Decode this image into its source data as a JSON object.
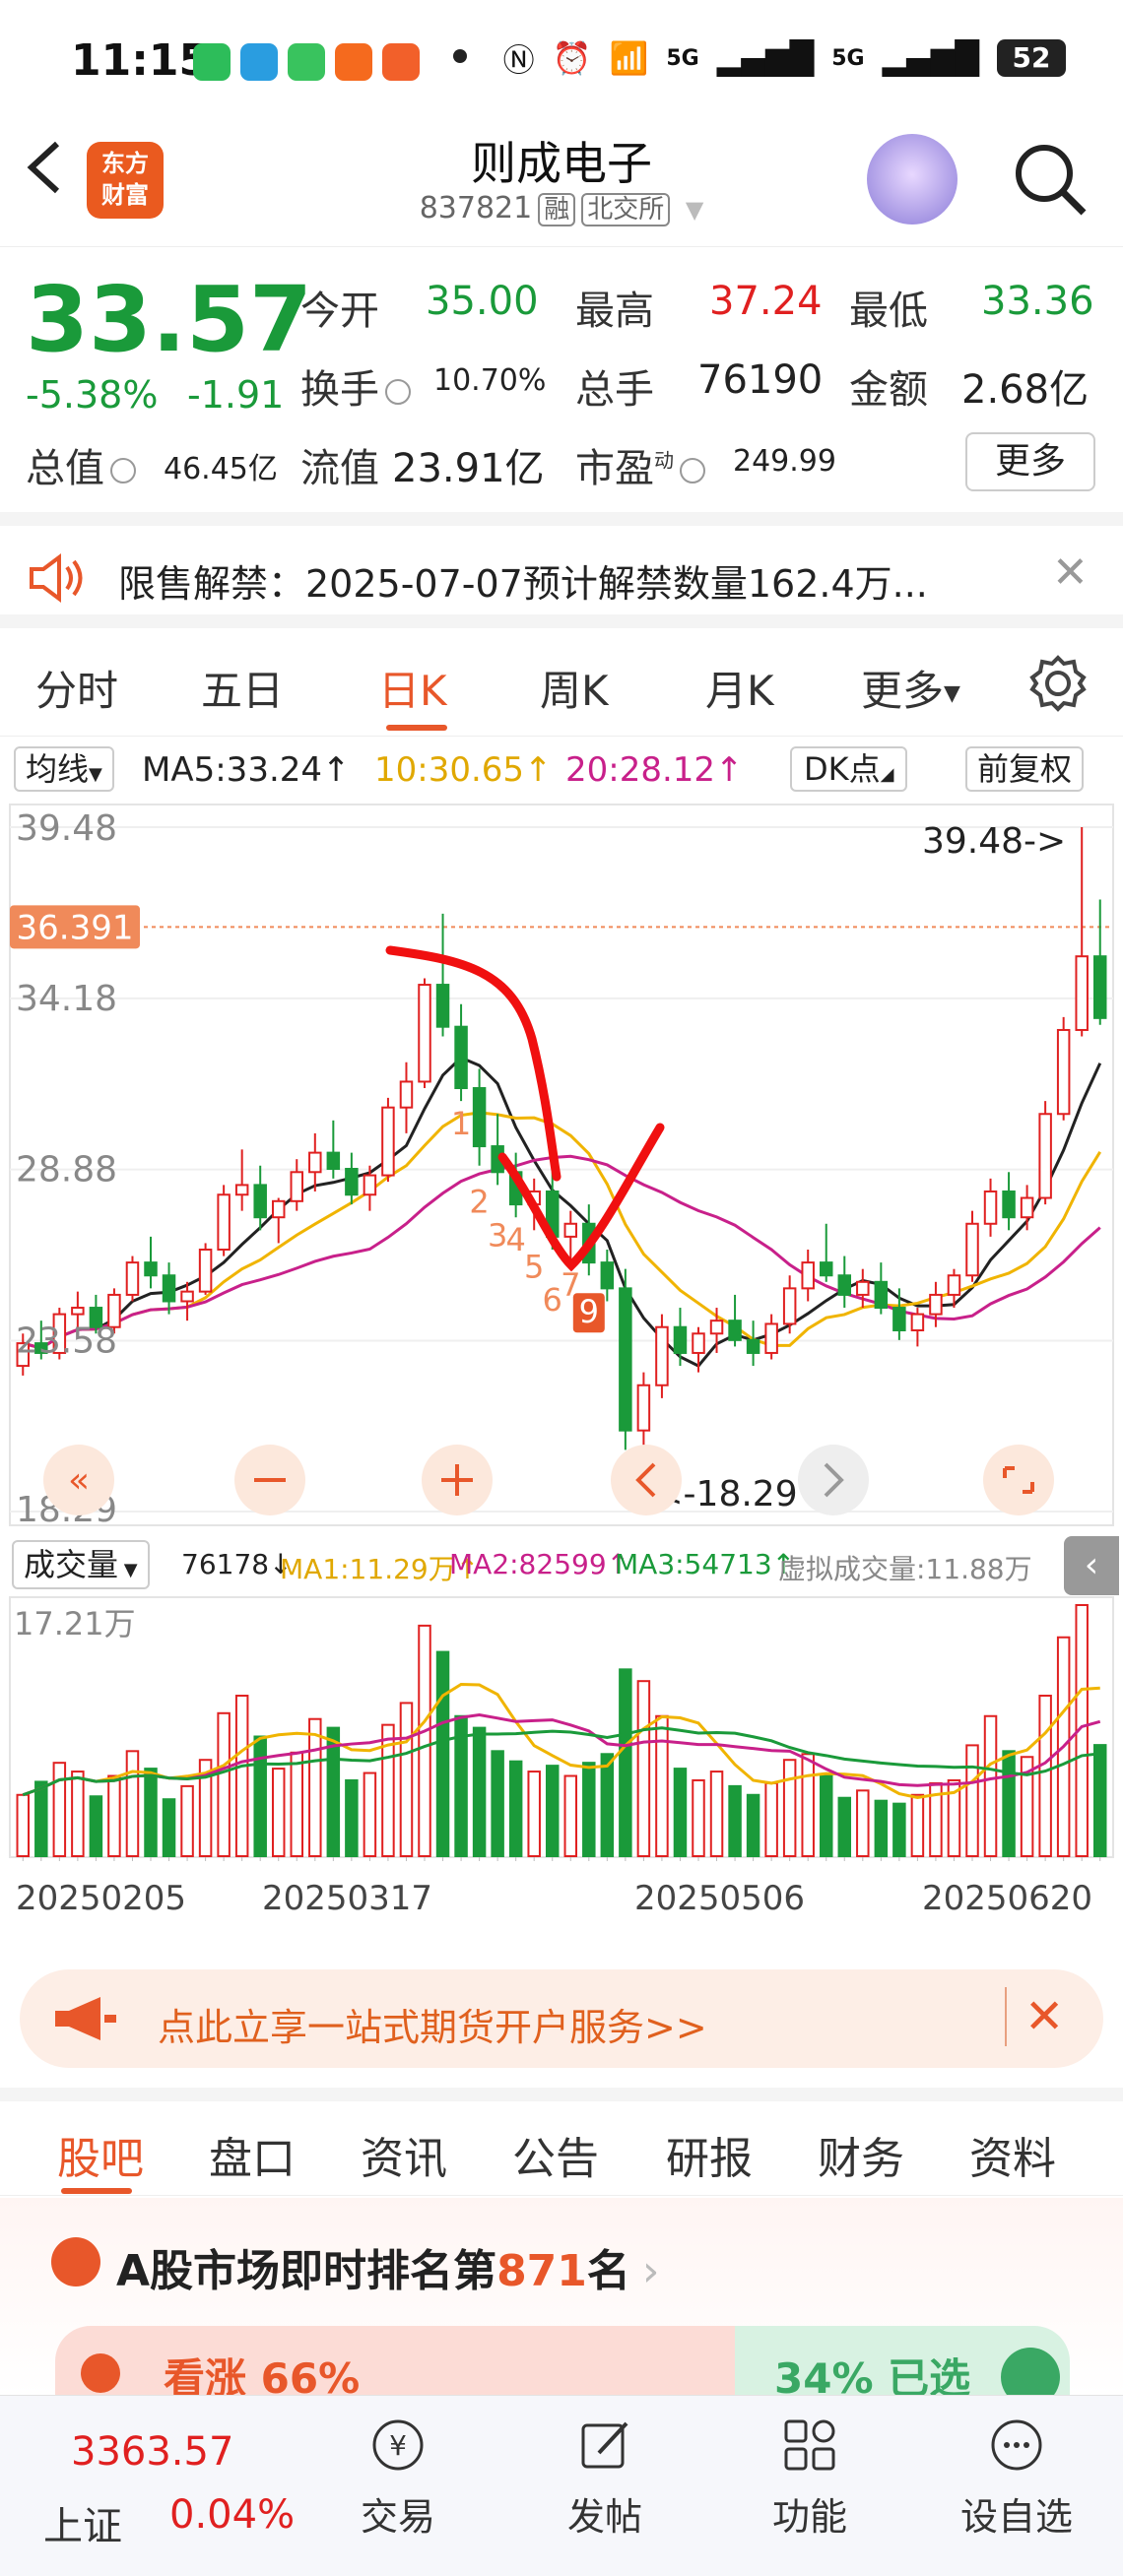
{
  "status_bar": {
    "time": "11:15",
    "battery": "52",
    "network_1": "5G",
    "network_2": "5G",
    "icons": [
      "wechat-icon",
      "telegram-icon",
      "message-icon",
      "app-icon",
      "app2-icon",
      "nfc-icon",
      "alarm-icon",
      "wifi-icon",
      "signal-icon"
    ]
  },
  "header": {
    "logo_line1": "东方",
    "logo_line2": "财富",
    "name": "则成电子",
    "code": "837821",
    "tag_margin": "融",
    "tag_exchange": "北交所"
  },
  "quote": {
    "price": "33.57",
    "change_pct": "-5.38%",
    "change": "-1.91",
    "open_label": "今开",
    "open": "35.00",
    "high_label": "最高",
    "high": "37.24",
    "low_label": "最低",
    "low": "33.36",
    "turnover_label": "换手",
    "turnover": "10.70%",
    "volume_label": "总手",
    "volume": "76190",
    "amount_label": "金额",
    "amount": "2.68亿",
    "mktcap_label": "总值",
    "mktcap": "46.45亿",
    "float_label": "流值",
    "float_cap": "23.91亿",
    "pe_label": "市盈",
    "pe_sup": "动",
    "pe": "249.99",
    "more": "更多"
  },
  "notice": {
    "text": "限售解禁：2025-07-07预计解禁数量162.4万..."
  },
  "period_tabs": [
    "分时",
    "五日",
    "日K",
    "周K",
    "月K",
    "更多"
  ],
  "indicator": {
    "selector": "均线",
    "ma5": "MA5:33.24↑",
    "ma10": "10:30.65↑",
    "ma20": "20:28.12↑",
    "dk": "DK点",
    "adjust": "前复权"
  },
  "colors": {
    "up": "#e02020",
    "down": "#1a9a3a",
    "accent": "#e8572a",
    "ma5": "#222222",
    "ma10": "#f0b400",
    "ma20": "#c8208a"
  },
  "chart_data": [
    {
      "type": "candlestick",
      "title": "",
      "x_start": "20250205",
      "x_end": "20250620",
      "x_tick_labels": [
        "20250205",
        "20250317",
        "20250506",
        "20250620"
      ],
      "y_tick_labels": [
        "39.48",
        "34.18",
        "28.88",
        "23.58",
        "18.29"
      ],
      "ylim": [
        18.29,
        39.48
      ],
      "price_marker": "36.391",
      "max_marker": "39.48->",
      "min_marker": "<-18.29",
      "signal_numbers": [
        "1",
        "2",
        "3",
        "4",
        "5",
        "6",
        "7",
        "9"
      ],
      "ohlc": [
        [
          22.8,
          23.8,
          22.5,
          23.5
        ],
        [
          23.5,
          24.2,
          23.0,
          23.2
        ],
        [
          23.2,
          24.6,
          23.0,
          24.4
        ],
        [
          24.4,
          25.1,
          24.0,
          24.6
        ],
        [
          24.6,
          25.0,
          23.8,
          24.0
        ],
        [
          24.0,
          25.2,
          23.8,
          25.0
        ],
        [
          25.0,
          26.2,
          24.8,
          26.0
        ],
        [
          26.0,
          26.8,
          25.2,
          25.6
        ],
        [
          25.6,
          26.0,
          24.4,
          24.8
        ],
        [
          24.8,
          25.4,
          24.2,
          25.1
        ],
        [
          25.1,
          26.6,
          25.0,
          26.4
        ],
        [
          26.4,
          28.4,
          26.2,
          28.1
        ],
        [
          28.1,
          29.5,
          27.6,
          28.4
        ],
        [
          28.4,
          29.0,
          27.0,
          27.4
        ],
        [
          27.4,
          28.0,
          26.6,
          27.9
        ],
        [
          27.9,
          29.2,
          27.6,
          28.8
        ],
        [
          28.8,
          30.0,
          28.2,
          29.4
        ],
        [
          29.4,
          30.4,
          28.6,
          28.9
        ],
        [
          28.9,
          29.4,
          27.8,
          28.1
        ],
        [
          28.1,
          29.0,
          27.6,
          28.7
        ],
        [
          28.7,
          31.1,
          28.5,
          30.8
        ],
        [
          30.8,
          32.2,
          30.0,
          31.6
        ],
        [
          31.6,
          34.8,
          31.4,
          34.6
        ],
        [
          34.6,
          36.8,
          33.0,
          33.3
        ],
        [
          33.3,
          34.0,
          31.0,
          31.4
        ],
        [
          31.4,
          32.0,
          29.0,
          29.6
        ],
        [
          29.6,
          30.6,
          28.4,
          28.8
        ],
        [
          28.8,
          29.4,
          27.4,
          27.8
        ],
        [
          27.8,
          28.6,
          27.0,
          28.2
        ],
        [
          28.2,
          28.8,
          26.4,
          26.8
        ],
        [
          26.8,
          27.6,
          26.0,
          27.2
        ],
        [
          27.2,
          27.8,
          25.6,
          26.0
        ],
        [
          26.0,
          26.4,
          24.8,
          25.2
        ],
        [
          25.2,
          25.8,
          20.2,
          20.8
        ],
        [
          20.8,
          22.6,
          18.29,
          22.2
        ],
        [
          22.2,
          24.4,
          21.8,
          24.0
        ],
        [
          24.0,
          24.6,
          22.8,
          23.2
        ],
        [
          23.2,
          24.0,
          22.6,
          23.8
        ],
        [
          23.8,
          24.6,
          23.2,
          24.2
        ],
        [
          24.2,
          25.0,
          23.4,
          23.6
        ],
        [
          23.6,
          24.2,
          22.8,
          23.2
        ],
        [
          23.2,
          24.4,
          23.0,
          24.1
        ],
        [
          24.1,
          25.6,
          23.8,
          25.2
        ],
        [
          25.2,
          26.4,
          24.8,
          26.0
        ],
        [
          26.0,
          27.2,
          25.4,
          25.6
        ],
        [
          25.6,
          26.2,
          24.6,
          25.0
        ],
        [
          25.0,
          25.8,
          24.6,
          25.4
        ],
        [
          25.4,
          26.0,
          24.4,
          24.6
        ],
        [
          24.6,
          25.2,
          23.6,
          23.9
        ],
        [
          23.9,
          24.6,
          23.4,
          24.4
        ],
        [
          24.4,
          25.4,
          24.0,
          25.0
        ],
        [
          25.0,
          25.8,
          24.6,
          25.6
        ],
        [
          25.6,
          27.6,
          25.4,
          27.2
        ],
        [
          27.2,
          28.6,
          26.8,
          28.2
        ],
        [
          28.2,
          28.8,
          27.0,
          27.4
        ],
        [
          27.4,
          28.4,
          27.0,
          28.0
        ],
        [
          28.0,
          31.0,
          27.8,
          30.6
        ],
        [
          30.6,
          33.6,
          30.4,
          33.2
        ],
        [
          33.2,
          39.48,
          33.0,
          35.48
        ],
        [
          35.48,
          37.24,
          33.36,
          33.57
        ]
      ]
    },
    {
      "type": "bar",
      "title": "",
      "label": "成交量",
      "y_tick_label": "17.21万",
      "current": "76178↓",
      "ma1": "MA1:11.29万↑",
      "ma2": "MA2:82599↑",
      "ma3": "MA3:54713↑",
      "virtual": "虚拟成交量:11.88万",
      "ylim": [
        0,
        172100
      ],
      "volumes": [
        42000,
        51000,
        64000,
        58000,
        41000,
        55000,
        72000,
        60000,
        39000,
        48000,
        66000,
        98000,
        110000,
        82000,
        60000,
        71000,
        94000,
        88000,
        52000,
        57000,
        90000,
        105000,
        158000,
        140000,
        96000,
        88000,
        72000,
        65000,
        58000,
        62000,
        55000,
        64000,
        70000,
        128000,
        120000,
        96000,
        60000,
        52000,
        58000,
        48000,
        42000,
        50000,
        66000,
        70000,
        55000,
        40000,
        45000,
        38000,
        36000,
        42000,
        50000,
        52000,
        76000,
        96000,
        72000,
        68000,
        110000,
        150000,
        172100,
        76178
      ]
    }
  ],
  "ad": {
    "text": "点此立享一站式期货开户服务>>"
  },
  "bottom_tabs": [
    "股吧",
    "盘口",
    "资讯",
    "公告",
    "研报",
    "财务",
    "资料"
  ],
  "rank": {
    "prefix": "A股市场即时排名第",
    "number": "871",
    "suffix": "名"
  },
  "vote": {
    "bull": "看涨 66%",
    "bear": "34% 已选"
  },
  "navbar": {
    "index_value": "3363.57",
    "index_name": "上证",
    "index_pct": "0.04%",
    "items": [
      "交易",
      "发帖",
      "功能",
      "设自选"
    ]
  }
}
